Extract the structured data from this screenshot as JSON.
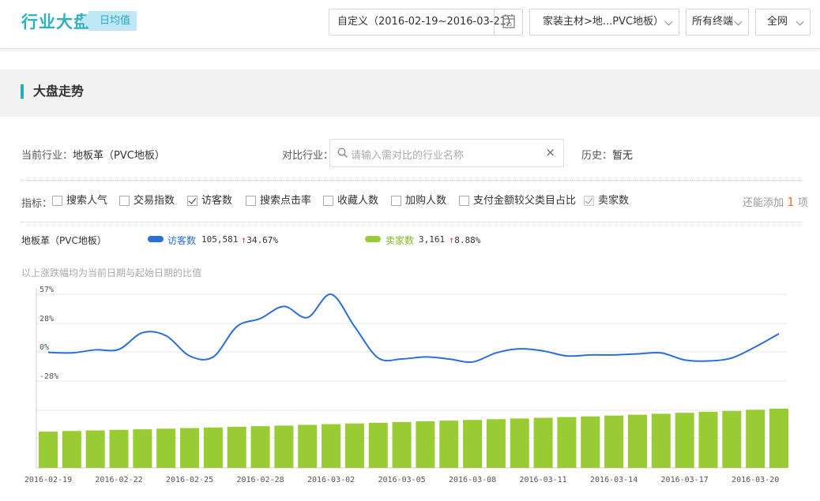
{
  "header": {
    "title": "行业大盘",
    "badge": "日均值",
    "date_range": "自定义（2016-02-19~2016-03-21）",
    "calendar_day": "15",
    "category": "家装主材>地...PVC地板）",
    "terminal": "所有终端",
    "network": "全网"
  },
  "section": {
    "title": "大盘走势"
  },
  "filters": {
    "current_label": "当前行业：",
    "current_value": "地板革（PVC地板）",
    "compare_label": "对比行业：",
    "compare_placeholder": "请输入需对比的行业名称",
    "history_label": "历史：",
    "history_value": "暂无"
  },
  "metrics": {
    "label": "指标：",
    "items": [
      {
        "label": "搜索人气",
        "checked": false
      },
      {
        "label": "交易指数",
        "checked": false
      },
      {
        "label": "访客数",
        "checked": true
      },
      {
        "label": "搜索点击率",
        "checked": false
      },
      {
        "label": "收藏人数",
        "checked": false
      },
      {
        "label": "加购人数",
        "checked": false
      },
      {
        "label": "支付金额较父类目占比",
        "checked": false
      },
      {
        "label": "卖家数",
        "checked": true,
        "disabled": true
      }
    ],
    "remaining_prefix": "还能添加",
    "remaining_count": "1",
    "remaining_suffix": "项"
  },
  "legend": {
    "industry": "地板革（PVC地板）",
    "visitors_name": "访客数",
    "visitors_value": "105,581",
    "visitors_change": "34.67%",
    "sellers_name": "卖家数",
    "sellers_value": "3,161",
    "sellers_change": "8.88%"
  },
  "note": "以上涨跌幅均为当前日期与起始日期的比值",
  "colors": {
    "accent": "#2db2c0",
    "visitors": "#2a6fd6",
    "sellers": "#99cc33",
    "up": "#f04a3a"
  },
  "chart_data": {
    "type": "line",
    "x": [
      "2016-02-19",
      "2016-02-20",
      "2016-02-21",
      "2016-02-22",
      "2016-02-23",
      "2016-02-24",
      "2016-02-25",
      "2016-02-26",
      "2016-02-27",
      "2016-02-28",
      "2016-02-29",
      "2016-03-01",
      "2016-03-02",
      "2016-03-03",
      "2016-03-04",
      "2016-03-05",
      "2016-03-06",
      "2016-03-07",
      "2016-03-08",
      "2016-03-09",
      "2016-03-10",
      "2016-03-11",
      "2016-03-12",
      "2016-03-13",
      "2016-03-14",
      "2016-03-15",
      "2016-03-16",
      "2016-03-17",
      "2016-03-18",
      "2016-03-19",
      "2016-03-20",
      "2016-03-21"
    ],
    "x_tick_labels": [
      "2016-02-19",
      "2016-02-22",
      "2016-02-25",
      "2016-02-28",
      "2016-03-02",
      "2016-03-05",
      "2016-03-08",
      "2016-03-11",
      "2016-03-14",
      "2016-03-17",
      "2016-03-20"
    ],
    "y_tick_labels": [
      "57%",
      "28%",
      "0%",
      "-28%"
    ],
    "ylim": [
      -28,
      57
    ],
    "series": [
      {
        "name": "访客数",
        "unit": "%",
        "values": [
          -0.5,
          -1,
          2,
          2.5,
          19,
          16,
          -4,
          -5,
          25,
          33,
          45,
          34,
          57,
          25,
          -6,
          -7,
          -5,
          -7,
          -10,
          -1,
          3,
          1,
          -4,
          -3,
          -3,
          -2,
          -1,
          -8,
          -9,
          -6,
          5,
          18
        ]
      },
      {
        "name": "卖家数",
        "unit": "relative",
        "values": [
          3.07,
          3.12,
          3.17,
          3.22,
          3.27,
          3.32,
          3.37,
          3.42,
          3.48,
          3.53,
          3.58,
          3.64,
          3.7,
          3.76,
          3.82,
          3.88,
          3.94,
          4.0,
          4.06,
          4.12,
          4.18,
          4.24,
          4.3,
          4.36,
          4.43,
          4.5,
          4.58,
          4.66,
          4.74,
          4.82,
          4.92,
          5.01
        ]
      }
    ],
    "grid": true,
    "legend_position": "top-left"
  }
}
